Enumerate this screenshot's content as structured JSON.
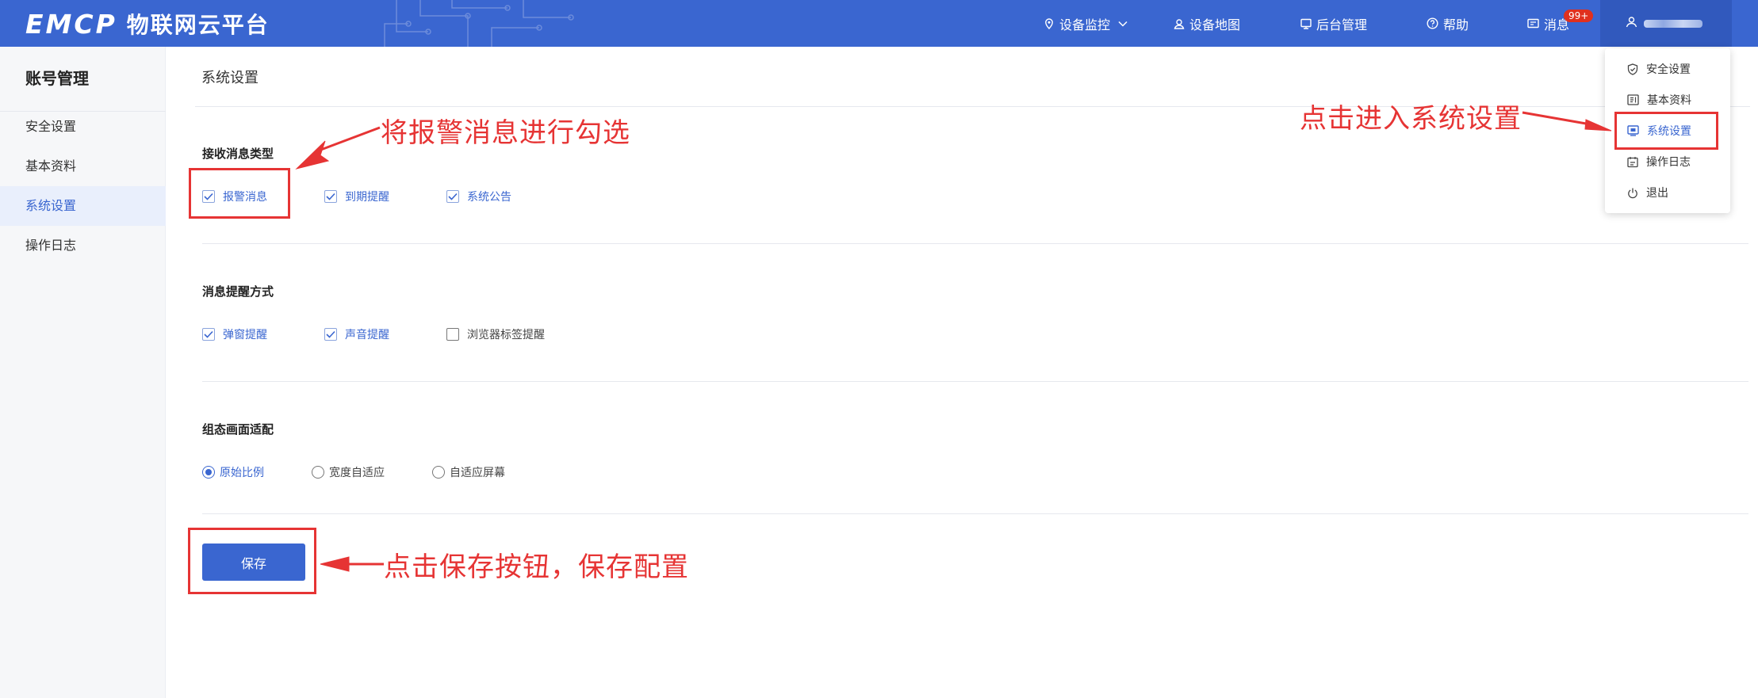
{
  "brand": {
    "mark": "EMCP",
    "name": "物联网云平台"
  },
  "nav": {
    "device_monitor": "设备监控",
    "device_map": "设备地图",
    "admin": "后台管理",
    "help": "帮助",
    "messages": "消息",
    "messages_badge": "99+"
  },
  "sidebar": {
    "title": "账号管理",
    "items": [
      {
        "label": "安全设置"
      },
      {
        "label": "基本资料"
      },
      {
        "label": "系统设置"
      },
      {
        "label": "操作日志"
      }
    ]
  },
  "main": {
    "title": "系统设置",
    "receive_types": {
      "title": "接收消息类型",
      "options": [
        {
          "label": "报警消息",
          "checked": true
        },
        {
          "label": "到期提醒",
          "checked": true
        },
        {
          "label": "系统公告",
          "checked": true
        }
      ]
    },
    "remind_methods": {
      "title": "消息提醒方式",
      "options": [
        {
          "label": "弹窗提醒",
          "checked": true
        },
        {
          "label": "声音提醒",
          "checked": true
        },
        {
          "label": "浏览器标签提醒",
          "checked": false
        }
      ]
    },
    "screen_fit": {
      "title": "组态画面适配",
      "options": [
        {
          "label": "原始比例",
          "selected": true
        },
        {
          "label": "宽度自适应",
          "selected": false
        },
        {
          "label": "自适应屏幕",
          "selected": false
        }
      ]
    },
    "save_label": "保存"
  },
  "user_menu": {
    "items": [
      {
        "label": "安全设置"
      },
      {
        "label": "基本资料"
      },
      {
        "label": "系统设置"
      },
      {
        "label": "操作日志"
      },
      {
        "label": "退出"
      }
    ]
  },
  "annotations": {
    "check_alarm": "将报警消息进行勾选",
    "enter_settings": "点击进入系统设置",
    "click_save": "点击保存按钮，保存配置"
  },
  "colors": {
    "primary": "#3a66d0",
    "topbar": "#3a66d0",
    "annotation_red": "#e63434",
    "badge": "#e0301e"
  }
}
